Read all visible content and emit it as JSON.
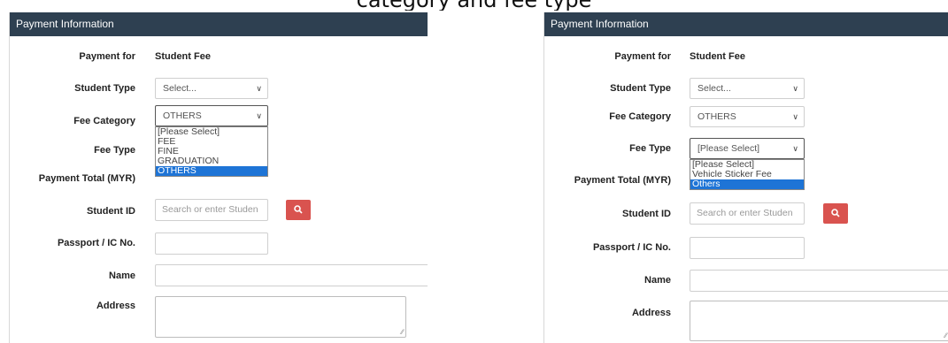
{
  "caption": "category and fee type",
  "panels": [
    {
      "header": "Payment Information",
      "labels": {
        "payment_for": "Payment for",
        "student_type": "Student Type",
        "fee_category": "Fee Category",
        "fee_type": "Fee Type",
        "payment_total": "Payment Total (MYR)",
        "student_id": "Student ID",
        "passport": "Passport / IC No.",
        "name": "Name",
        "address": "Address"
      },
      "payment_for_value": "Student Fee",
      "student_type_value": "Select...",
      "fee_category_value": "OTHERS",
      "student_id_placeholder": "Search or enter Studen",
      "dropdown_options": [
        "[Please Select]",
        "FEE",
        "FINE",
        "GRADUATION",
        "OTHERS"
      ],
      "dropdown_selected": "OTHERS"
    },
    {
      "header": "Payment Information",
      "labels": {
        "payment_for": "Payment for",
        "student_type": "Student Type",
        "fee_category": "Fee Category",
        "fee_type": "Fee Type",
        "payment_total": "Payment Total (MYR)",
        "student_id": "Student ID",
        "passport": "Passport / IC No.",
        "name": "Name",
        "address": "Address"
      },
      "payment_for_value": "Student Fee",
      "student_type_value": "Select...",
      "fee_category_value": "OTHERS",
      "fee_type_value": "[Please Select]",
      "student_id_placeholder": "Search or enter Studen",
      "dropdown_options": [
        "[Please Select]",
        "Vehicle Sticker Fee",
        "Others"
      ],
      "dropdown_selected": "Others"
    }
  ],
  "icons": {
    "search": "search-icon",
    "chevron": "chevron-down-icon",
    "resize": "resize-handle-icon"
  },
  "colors": {
    "header_bg": "#2e4051",
    "search_button": "#d9534f",
    "option_highlight": "#1e74d6"
  }
}
